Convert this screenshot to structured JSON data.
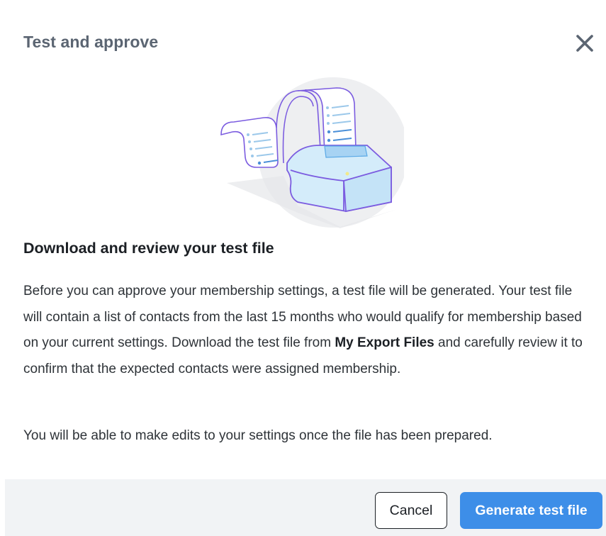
{
  "header": {
    "title": "Test and approve",
    "close_icon": "close-icon"
  },
  "illustration": {
    "icon": "receipt-printer-illustration",
    "colors": {
      "accent": "#7b5ce0",
      "paper": "#ffffff",
      "box": "#d4ecfa",
      "backdrop": "#eeeff1"
    }
  },
  "content": {
    "heading": "Download and review your test file",
    "paragraph_before": "Before you can approve your membership settings, a test file will be generated. Your test file will contain a list of contacts from the last 15 months who would qualify for membership based on your current settings. Download the test file from ",
    "paragraph_bold": "My Export Files",
    "paragraph_after": " and carefully review it to confirm that the expected contacts were assigned membership.",
    "note": "You will be able to make edits to your settings once the file has been prepared."
  },
  "footer": {
    "cancel_label": "Cancel",
    "primary_label": "Generate test file",
    "colors": {
      "primary": "#3d8ee8",
      "footer_bg": "#f1f3f5"
    }
  }
}
